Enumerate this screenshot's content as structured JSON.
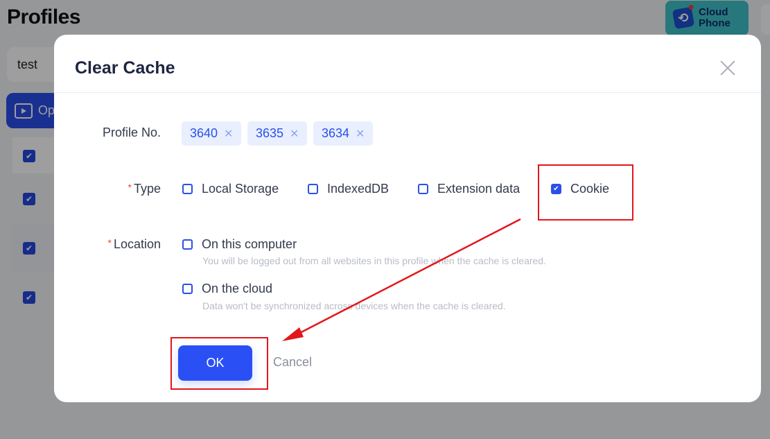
{
  "background": {
    "page_title": "Profiles",
    "search_value": "test",
    "open_button_label": "Op",
    "row_checkboxes": [
      true,
      true,
      true,
      true
    ],
    "cloud_phone": {
      "line1": "Cloud",
      "line2": "Phone"
    }
  },
  "modal": {
    "title": "Clear Cache",
    "profile_label": "Profile No.",
    "profiles": [
      {
        "id": "3640",
        "remove": "✕"
      },
      {
        "id": "3635",
        "remove": "✕"
      },
      {
        "id": "3634",
        "remove": "✕"
      }
    ],
    "type_label": "Type",
    "required_mark": "*",
    "types": [
      {
        "label": "Local Storage",
        "checked": false
      },
      {
        "label": "IndexedDB",
        "checked": false
      },
      {
        "label": "Extension data",
        "checked": false
      },
      {
        "label": "Cookie",
        "checked": true
      }
    ],
    "location_label": "Location",
    "locations": [
      {
        "label": "On this computer",
        "checked": false,
        "hint": "You will be logged out from all websites in this profile when the cache is cleared."
      },
      {
        "label": "On the cloud",
        "checked": false,
        "hint": "Data won't be synchronized across devices when the cache is cleared."
      }
    ],
    "ok_label": "OK",
    "cancel_label": "Cancel",
    "check_glyph": "✔"
  },
  "annotation_color": "#e3161b"
}
